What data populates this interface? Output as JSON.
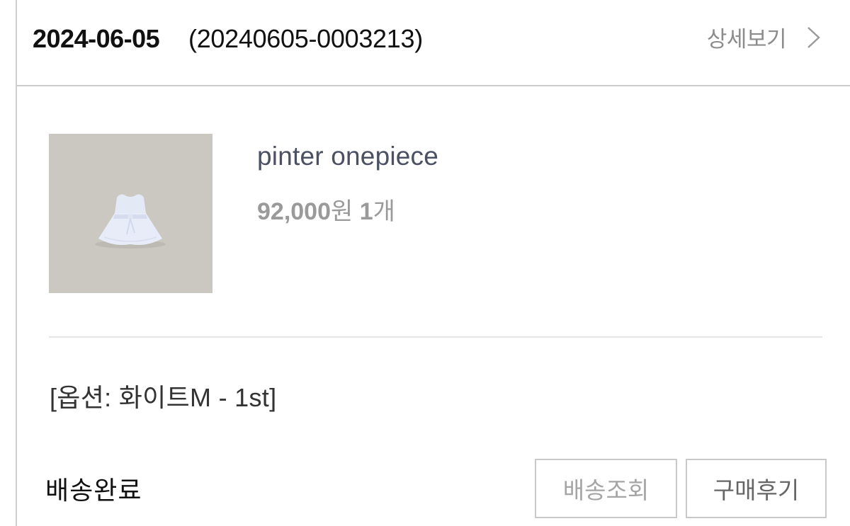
{
  "order": {
    "date": "2024-06-05",
    "number": "(20240605-0003213)",
    "detail_label": "상세보기"
  },
  "product": {
    "name": "pinter onepiece",
    "price": "92,000",
    "price_unit": "원",
    "quantity": "1",
    "quantity_unit": "개",
    "option": "[옵션: 화이트M - 1st]"
  },
  "status": {
    "label": "배송완료"
  },
  "actions": {
    "track_label": "배송조회",
    "review_label": "구매후기"
  },
  "colors": {
    "thumbnail_bg": "#cbc8c1",
    "product_name": "#4b5063",
    "muted_text": "#9a9a9a",
    "border": "#c9c9c9"
  },
  "icons": {
    "detail": "chevron-right-icon",
    "thumbnail": "white-dress-thumbnail"
  }
}
